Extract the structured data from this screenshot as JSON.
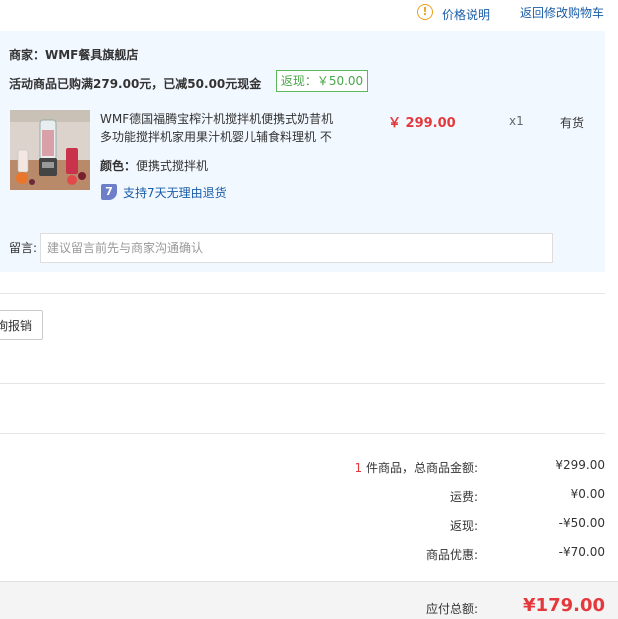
{
  "header": {
    "price_info_icon": "!",
    "price_info": "价格说明",
    "back_to_cart": "返回修改购物车"
  },
  "shop": {
    "merchant": "商家：WMF餐具旗舰店",
    "promotion": "活动商品已购满279.00元，已减50.00元现金",
    "rebate_tag": "返现：￥50.00"
  },
  "item": {
    "title": "WMF德国福腾宝榨汁机搅拌机便携式奶昔机多功能搅拌机家用果汁机婴儿辅食料理机 不",
    "price": "￥ 299.00",
    "quantity": "x1",
    "stock": "有货",
    "color_label": "颜色：",
    "color_value": "便携式搅拌机",
    "return_badge": "7",
    "return_policy": "支持7天无理由退货"
  },
  "note": {
    "label": "留言:",
    "placeholder": "建议留言前先与商家沟通确认"
  },
  "invoice": {
    "button": "询报销"
  },
  "summary": {
    "count": "1",
    "count_suffix": " 件商品，总商品金额:",
    "subtotal": "¥299.00",
    "shipping_label": "运费:",
    "shipping": "¥0.00",
    "rebate_label": "返现:",
    "rebate": "-¥50.00",
    "discount_label": "商品优惠:",
    "discount": "-¥70.00",
    "total_label": "应付总额:",
    "total": "¥179.00"
  },
  "colors": {
    "accent_red": "#e4393c",
    "link_blue": "#1a5da8",
    "panel_bg": "#f2f8ff",
    "rebate_green": "#4aa64a"
  }
}
